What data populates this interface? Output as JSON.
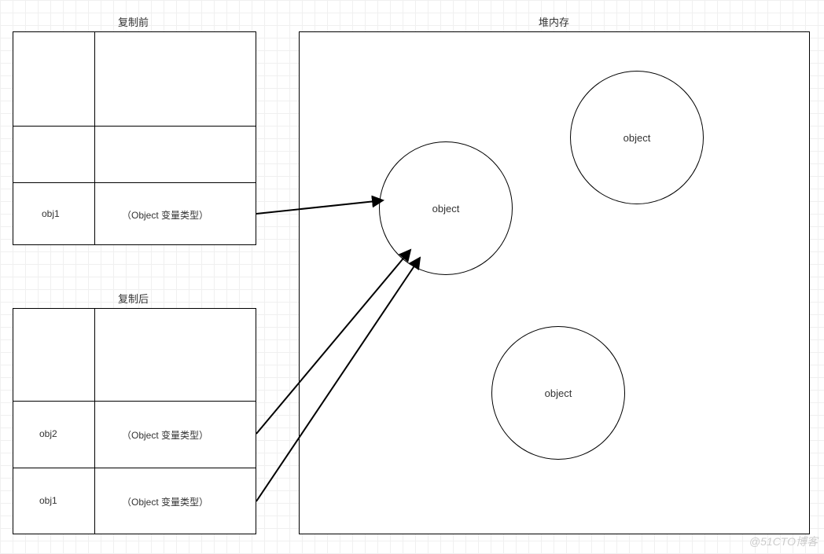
{
  "labels": {
    "before_copy": "复制前",
    "after_copy": "复制后",
    "heap_memory": "堆内存"
  },
  "table_before": {
    "rows": [
      {
        "left": "",
        "right": ""
      },
      {
        "left": "",
        "right": ""
      },
      {
        "left": "obj1",
        "right": "（Object 变量类型）"
      }
    ]
  },
  "table_after": {
    "rows": [
      {
        "left": "",
        "right": ""
      },
      {
        "left": "obj2",
        "right": "（Object 变量类型）"
      },
      {
        "left": "obj1",
        "right": "（Object 变量类型）"
      }
    ]
  },
  "heap": {
    "objects": [
      {
        "label": "object"
      },
      {
        "label": "object"
      },
      {
        "label": "object"
      }
    ]
  },
  "watermark": "@51CTO博客"
}
